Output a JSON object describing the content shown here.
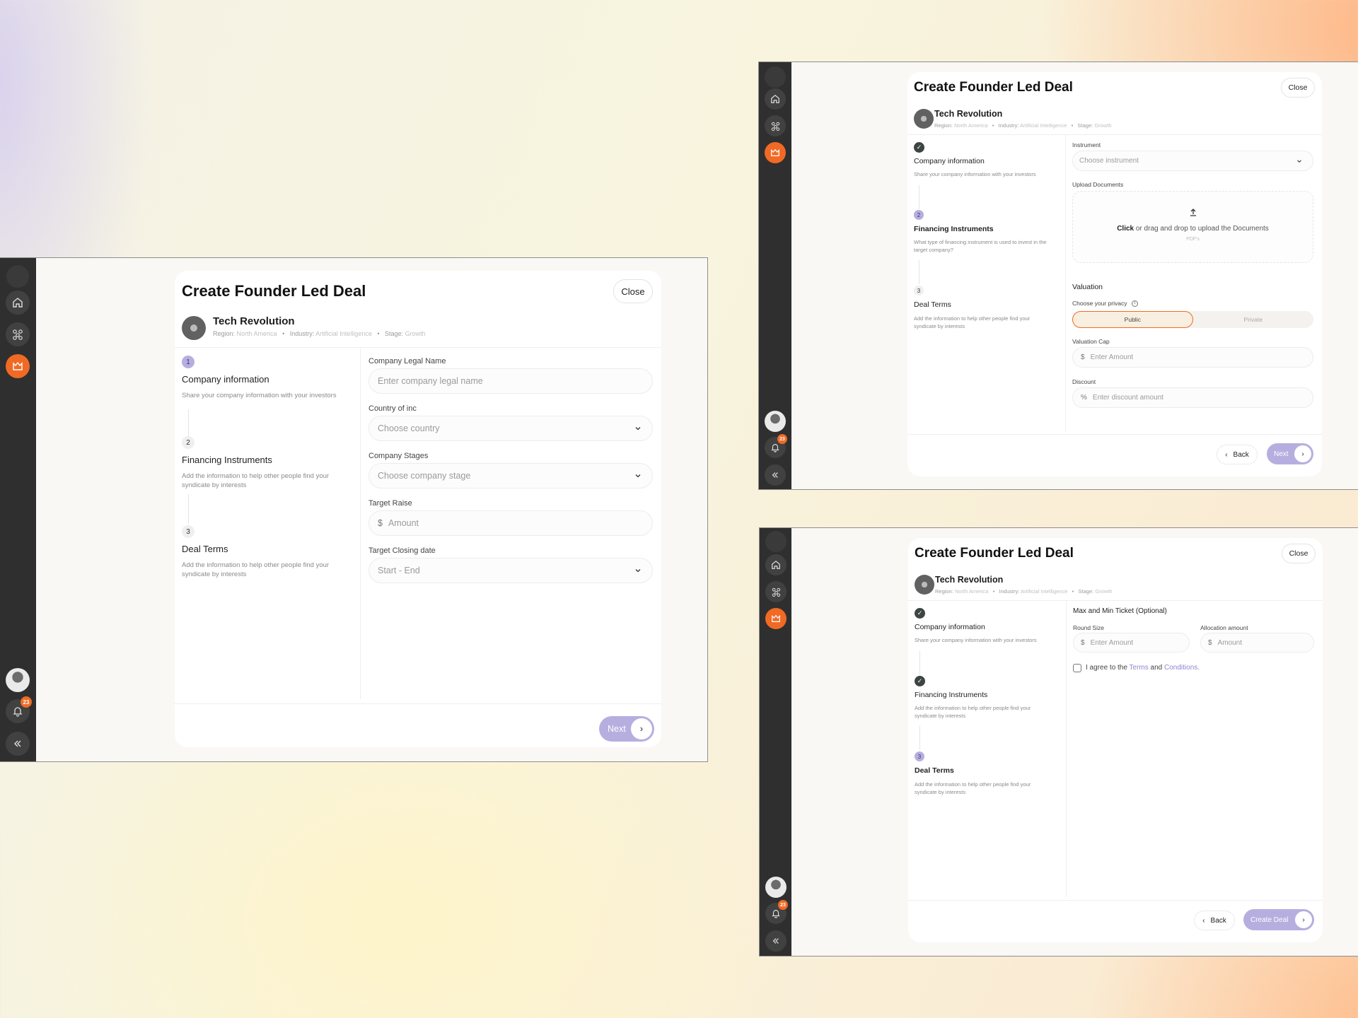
{
  "modal": {
    "title": "Create Founder Led Deal",
    "close_label": "Close"
  },
  "company": {
    "name": "Tech Revolution",
    "region_label": "Region:",
    "region": "North America",
    "industry_label": "Industry:",
    "industry": "Artificial Intelligence",
    "stage_label": "Stage:",
    "stage": "Growth",
    "separator": "•"
  },
  "sidebar": {
    "icons": [
      "logo-icon",
      "home-icon",
      "network-icon",
      "deals-icon",
      "user-avatar",
      "bell-icon",
      "collapse-icon"
    ],
    "notification_count": "23",
    "active_color": "#f06a25"
  },
  "screen1": {
    "steps": [
      {
        "num": "1",
        "title": "Company information",
        "desc": "Share your company information with your investors",
        "state": "active"
      },
      {
        "num": "2",
        "title": "Financing Instruments",
        "desc": "Add the information to help other people find your syndicate by interests",
        "state": "idle"
      },
      {
        "num": "3",
        "title": "Deal Terms",
        "desc": "Add the information to help other people find your syndicate by interests",
        "state": "idle"
      }
    ],
    "fields": {
      "legal_name_label": "Company Legal Name",
      "legal_name_placeholder": "Enter company legal name",
      "country_label": "Country of inc",
      "country_placeholder": "Choose country",
      "stage_label": "Company Stages",
      "stage_placeholder": "Choose company stage",
      "raise_label": "Target Raise",
      "raise_prefix": "$",
      "raise_placeholder": "Amount",
      "closing_label": "Target Closing date",
      "closing_placeholder": "Start - End"
    },
    "next_label": "Next"
  },
  "screen2": {
    "steps": [
      {
        "num": "✓",
        "title": "Company information",
        "desc": "Share your company information with your investors",
        "state": "done"
      },
      {
        "num": "2",
        "title": "Financing Instruments",
        "desc": "What type of financing instrument is used to invest in the target company?",
        "state": "active"
      },
      {
        "num": "3",
        "title": "Deal Terms",
        "desc": "Add the information to help other people find your syndicate by interests",
        "state": "idle"
      }
    ],
    "fields": {
      "instrument_label": "Instrument",
      "instrument_placeholder": "Choose instrument",
      "upload_label": "Upload Documents",
      "upload_click": "Click",
      "upload_text": " or drag and drop to upload the Documents",
      "upload_hint": "PDF's",
      "valuation_title": "Valuation",
      "privacy_label": "Choose your privacy",
      "privacy_public": "Public",
      "privacy_private": "Private",
      "cap_label": "Valuation Cap",
      "cap_prefix": "$",
      "cap_placeholder": "Enter Amount",
      "discount_label": "Discount",
      "discount_prefix": "%",
      "discount_placeholder": "Enter discount amount"
    },
    "back_label": "Back",
    "next_label": "Next"
  },
  "screen3": {
    "steps": [
      {
        "num": "✓",
        "title": "Company information",
        "desc": "Share your company information with your investors",
        "state": "done"
      },
      {
        "num": "✓",
        "title": "Financing Instruments",
        "desc": "Add the information to help other people find your syndicate by interests",
        "state": "done"
      },
      {
        "num": "3",
        "title": "Deal Terms",
        "desc": "Add the information to help other people find your syndicate by interests",
        "state": "active"
      }
    ],
    "fields": {
      "ticket_title": "Max and Min Ticket (Optional)",
      "round_label": "Round Size",
      "round_prefix": "$",
      "round_placeholder": "Enter Amount",
      "alloc_label": "Allocation amount",
      "alloc_prefix": "$",
      "alloc_placeholder": "Amount",
      "agree_pre": "I agree to the ",
      "agree_terms": "Terms",
      "agree_and": " and ",
      "agree_conditions": "Conditions."
    },
    "back_label": "Back",
    "create_label": "Create Deal"
  }
}
